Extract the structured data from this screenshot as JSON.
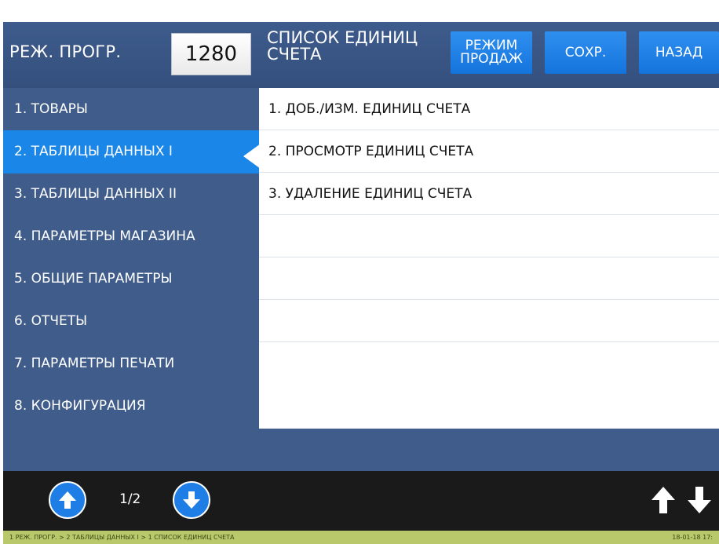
{
  "header": {
    "mode_label": "РЕЖ. ПРОГР.",
    "mode_value": "1280",
    "title_line1": "СПИСОК ЕДИНИЦ",
    "title_line2": "СЧЕТА",
    "buttons": {
      "sales_mode_line1": "РЕЖИМ",
      "sales_mode_line2": "ПРОДАЖ",
      "save": "СОХР.",
      "back": "НАЗАД"
    }
  },
  "menu": {
    "items": [
      {
        "label": "1. ТОВАРЫ"
      },
      {
        "label": "2. ТАБЛИЦЫ ДАННЫХ I"
      },
      {
        "label": "3. ТАБЛИЦЫ ДАННЫХ II"
      },
      {
        "label": "4. ПАРАМЕТРЫ МАГАЗИНА"
      },
      {
        "label": "5. ОБЩИЕ ПАРАМЕТРЫ"
      },
      {
        "label": "6. ОТЧЕТЫ"
      },
      {
        "label": "7. ПАРАМЕТРЫ ПЕЧАТИ"
      },
      {
        "label": "8. КОНФИГУРАЦИЯ"
      }
    ],
    "selected_index": 1
  },
  "content": {
    "rows": [
      {
        "label": "1. ДОБ./ИЗМ. ЕДИНИЦ СЧЕТА"
      },
      {
        "label": "2. ПРОСМОТР ЕДИНИЦ СЧЕТА"
      },
      {
        "label": "3. УДАЛЕНИЕ ЕДИНИЦ СЧЕТА"
      }
    ]
  },
  "footer": {
    "page": "1/2",
    "icons": {
      "page_up": "arrow-up-circle-icon",
      "page_down": "arrow-down-circle-icon",
      "row_up": "arrow-up-icon",
      "row_down": "arrow-down-icon"
    }
  },
  "status": {
    "path": "1 РЕЖ. ПРОГР. > 2 ТАБЛИЦЫ ДАННЫХ I > 1 СПИСОК ЕДИНИЦ СЧЕТА",
    "datetime": "18-01-18 17:"
  },
  "colors": {
    "background": "#3f5c8a",
    "accent": "#1a86e8",
    "bottom_bar": "#1a1a1a",
    "status_strip": "#b8c86b"
  }
}
